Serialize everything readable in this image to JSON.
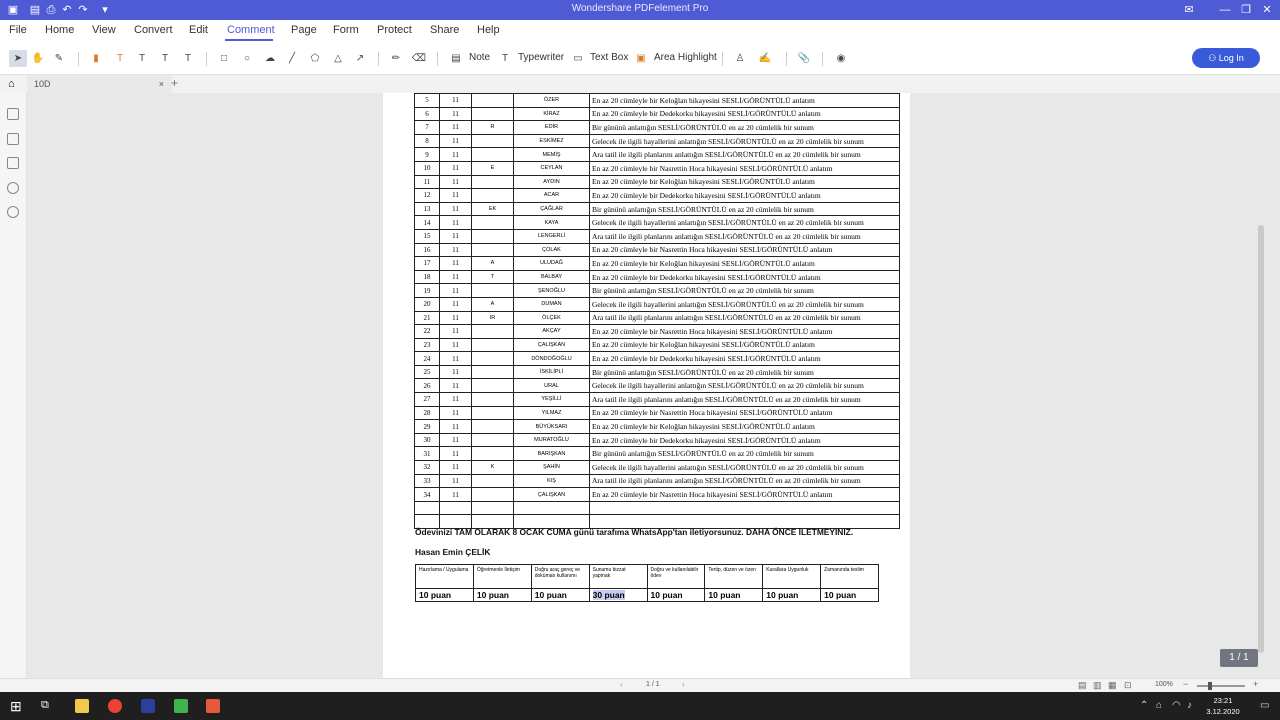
{
  "app": {
    "title": "Wondershare PDFelement Pro"
  },
  "menu": [
    "File",
    "Home",
    "View",
    "Convert",
    "Edit",
    "Comment",
    "Page",
    "Form",
    "Protect",
    "Share",
    "Help"
  ],
  "toolbar": {
    "note": "Note",
    "typewriter": "Typewriter",
    "textbox": "Text Box",
    "area_highlight": "Area Highlight",
    "login": "Log In"
  },
  "tab": {
    "name": "10D"
  },
  "schedule": {
    "rows": [
      {
        "n": "5",
        "c2": "11",
        "c3": "",
        "surname": "ÖZER",
        "task": "En az  20 cümleyle bir Keloğlan hikayesini SESLİ/GÖRÜNTÜLÜ anlatım"
      },
      {
        "n": "6",
        "c2": "11",
        "c3": "",
        "surname": "KİRAZ",
        "task": "En az  20 cümleyle bir Dedekorku hikayesini SESLİ/GÖRÜNTÜLÜ anlatım"
      },
      {
        "n": "7",
        "c2": "11",
        "c3": "R",
        "surname": "EDİR",
        "task": "Bir gününü anlattığın SESLİ/GÖRÜNTÜLÜ en az 20 cümlelik bir sunum"
      },
      {
        "n": "8",
        "c2": "11",
        "c3": "",
        "surname": "ESKİMEZ",
        "task": "Gelecek ile ilgili hayallerini anlattığın  SESLİ/GÖRÜNTÜLÜ en az 20 cümlelik bir sunum"
      },
      {
        "n": "9",
        "c2": "11",
        "c3": "",
        "surname": "MEMİŞ",
        "task": "Ara tatil ile ilgili planlarını anlattığın SESLİ/GÖRÜNTÜLÜ en az 20 cümlelik bir sunum"
      },
      {
        "n": "10",
        "c2": "11",
        "c3": "E",
        "surname": "CEYLAN",
        "task": "En az  20 cümleyle bir Nasrettin Hoca hikayesini SESLİ/GÖRÜNTÜLÜ anlatım"
      },
      {
        "n": "11",
        "c2": "11",
        "c3": "",
        "surname": "AYDIN",
        "task": "En az  20 cümleyle bir Keloğlan hikayesini SESLİ/GÖRÜNTÜLÜ anlatım"
      },
      {
        "n": "12",
        "c2": "11",
        "c3": "",
        "surname": "ACAR",
        "task": "En az  20 cümleyle bir Dedekorku hikayesini SESLİ/GÖRÜNTÜLÜ anlatım"
      },
      {
        "n": "13",
        "c2": "11",
        "c3": "EK",
        "surname": "ÇAĞLAR",
        "task": "Bir gününü anlattığın SESLİ/GÖRÜNTÜLÜ en az 20 cümlelik bir sunum"
      },
      {
        "n": "14",
        "c2": "11",
        "c3": "",
        "surname": "KAYA",
        "task": "Gelecek ile ilgili hayallerini anlattığın  SESLİ/GÖRÜNTÜLÜ en az 20 cümlelik bir sunum"
      },
      {
        "n": "15",
        "c2": "11",
        "c3": "",
        "surname": "LENGERLİ",
        "task": "Ara tatil ile ilgili planlarını anlattığın SESLİ/GÖRÜNTÜLÜ en az 20 cümlelik bir sunum"
      },
      {
        "n": "16",
        "c2": "11",
        "c3": "",
        "surname": "ÇOLAK",
        "task": "En az  20 cümleyle bir Nasrettin Hoca hikayesini SESLİ/GÖRÜNTÜLÜ anlatım"
      },
      {
        "n": "17",
        "c2": "11",
        "c3": "A",
        "surname": "ULUDAĞ",
        "task": "En az  20 cümleyle bir Keloğlan hikayesini SESLİ/GÖRÜNTÜLÜ anlatım"
      },
      {
        "n": "18",
        "c2": "11",
        "c3": "T",
        "surname": "BALBAY",
        "task": "En az  20 cümleyle bir Dedekorku hikayesini SESLİ/GÖRÜNTÜLÜ anlatım"
      },
      {
        "n": "19",
        "c2": "11",
        "c3": "",
        "surname": "ŞENOĞLU",
        "task": "Bir gününü anlattığın SESLİ/GÖRÜNTÜLÜ en az 20 cümlelik bir sunum"
      },
      {
        "n": "20",
        "c2": "11",
        "c3": "A",
        "surname": "DUMAN",
        "task": "Gelecek ile ilgili hayallerini anlattığın  SESLİ/GÖRÜNTÜLÜ en az 20 cümlelik bir sunum"
      },
      {
        "n": "21",
        "c2": "11",
        "c3": "IR",
        "surname": "ÖLÇEK",
        "task": "Ara tatil ile ilgili planlarını anlattığın SESLİ/GÖRÜNTÜLÜ en az 20 cümlelik bir sunum"
      },
      {
        "n": "22",
        "c2": "11",
        "c3": "",
        "surname": "AKÇAY",
        "task": "En az  20 cümleyle bir Nasrettin Hoca hikayesini SESLİ/GÖRÜNTÜLÜ anlatım"
      },
      {
        "n": "23",
        "c2": "11",
        "c3": "",
        "surname": "ÇALIŞKAN",
        "task": "En az  20 cümleyle bir Keloğlan hikayesini SESLİ/GÖRÜNTÜLÜ anlatım"
      },
      {
        "n": "24",
        "c2": "11",
        "c3": "",
        "surname": "DÖNDOĞOĞLU",
        "task": "En az  20 cümleyle bir Dedekorku hikayesini SESLİ/GÖRÜNTÜLÜ anlatım"
      },
      {
        "n": "25",
        "c2": "11",
        "c3": "",
        "surname": "İSKİLİPLİ",
        "task": "Bir gününü anlattığın SESLİ/GÖRÜNTÜLÜ en az 20 cümlelik bir sunum"
      },
      {
        "n": "26",
        "c2": "11",
        "c3": "",
        "surname": "URAL",
        "task": "Gelecek ile ilgili hayallerini anlattığın  SESLİ/GÖRÜNTÜLÜ en az 20 cümlelik bir sunum"
      },
      {
        "n": "27",
        "c2": "11",
        "c3": "",
        "surname": "YEŞİLLİ",
        "task": "Ara tatil ile ilgili planlarını anlattığın SESLİ/GÖRÜNTÜLÜ en az 20 cümlelik bir sunum"
      },
      {
        "n": "28",
        "c2": "11",
        "c3": "",
        "surname": "YILMAZ",
        "task": "En az  20 cümleyle bir Nasrettin Hoca hikayesini SESLİ/GÖRÜNTÜLÜ anlatım"
      },
      {
        "n": "29",
        "c2": "11",
        "c3": "",
        "surname": "BÜYÜKSARI",
        "task": "En az  20 cümleyle bir Keloğlan hikayesini SESLİ/GÖRÜNTÜLÜ anlatım"
      },
      {
        "n": "30",
        "c2": "11",
        "c3": "",
        "surname": "MURATOĞLU",
        "task": "En az  20 cümleyle bir Dedekorku hikayesini SESLİ/GÖRÜNTÜLÜ anlatım"
      },
      {
        "n": "31",
        "c2": "11",
        "c3": "",
        "surname": "BARIŞKAN",
        "task": "Bir gününü anlattığın SESLİ/GÖRÜNTÜLÜ en az 20 cümlelik bir sunum"
      },
      {
        "n": "32",
        "c2": "11",
        "c3": "K",
        "surname": "ŞAHİN",
        "task": "Gelecek ile ilgili hayallerini anlattığın  SESLİ/GÖRÜNTÜLÜ en az 20 cümlelik bir sunum"
      },
      {
        "n": "33",
        "c2": "11",
        "c3": "",
        "surname": "KIŞ",
        "task": "Ara tatil ile ilgili planlarını anlattığın SESLİ/GÖRÜNTÜLÜ en az 20 cümlelik bir sunum"
      },
      {
        "n": "34",
        "c2": "11",
        "c3": "",
        "surname": "ÇALIŞKAN",
        "task": "En az  20 cümleyle bir Nasrettin Hoca hikayesini SESLİ/GÖRÜNTÜLÜ anlatım"
      }
    ]
  },
  "notice": "Ödevinizi TAM OLARAK 8 OCAK CUMA günü tarafıma WhatsApp'tan iletiyorsunuz. DAHA ÖNCE İLETMEYİNİZ.",
  "teacher": "Hasan Emin ÇELİK",
  "rubric": {
    "criteria": [
      "Hazırlama / Uygulama",
      "Öğretmenle İletişim",
      "Doğru araç gereç ve doküman kullanımı",
      "Sunumu bizzat yapmak",
      "Doğru ve kullanılabilir ödev",
      "Tertip, düzen ve özen",
      "Kurallara Uygunluk",
      "Zamanında teslim"
    ],
    "points": [
      "10 puan",
      "10 puan",
      "10 puan",
      "30 puan",
      "10 puan",
      "10 puan",
      "10 puan",
      "10 puan"
    ]
  },
  "page_badge": "1 / 1",
  "status": {
    "page": "1 / 1",
    "zoom": "100%"
  },
  "clock": {
    "time": "23:21",
    "date": "3.12.2020"
  }
}
